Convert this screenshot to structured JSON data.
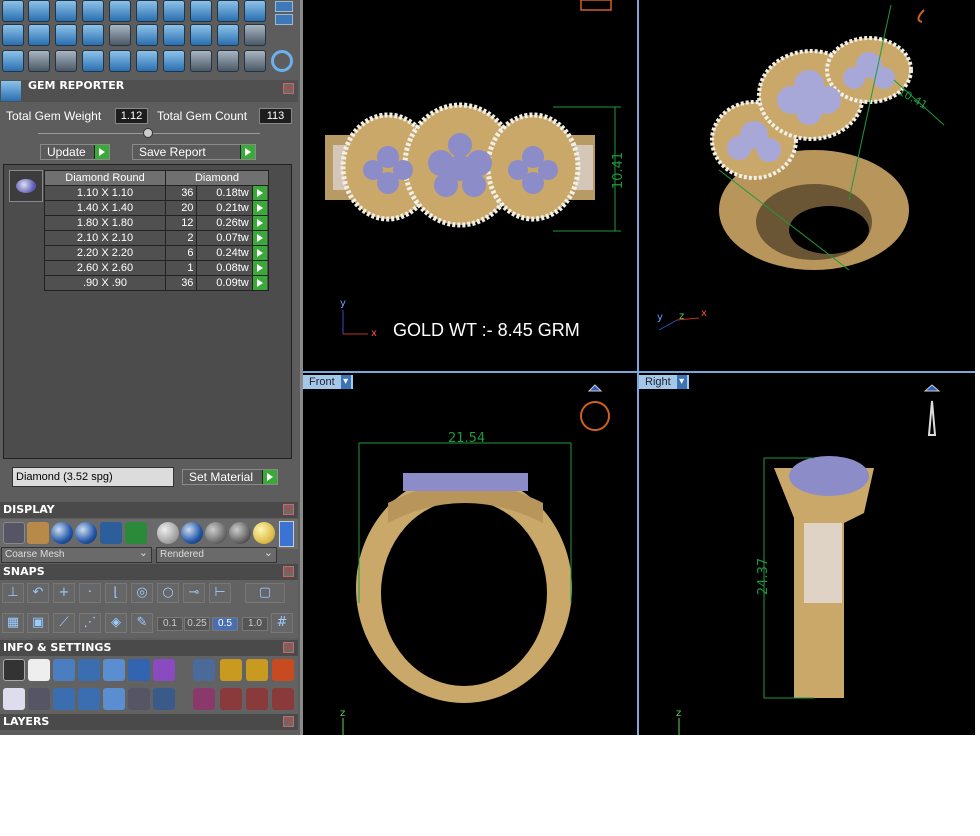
{
  "gem_reporter": {
    "title": "GEM REPORTER",
    "total_weight_label": "Total Gem Weight",
    "total_weight_value": "1.12",
    "total_count_label": "Total Gem Count",
    "total_count_value": "113",
    "update_label": "Update",
    "save_report_label": "Save Report",
    "table": {
      "headers": [
        "Diamond Round",
        "Diamond"
      ],
      "rows": [
        {
          "size": "1.10 X 1.10",
          "count": "36",
          "weight": "0.18tw"
        },
        {
          "size": "1.40 X 1.40",
          "count": "20",
          "weight": "0.21tw"
        },
        {
          "size": "1.80 X 1.80",
          "count": "12",
          "weight": "0.26tw"
        },
        {
          "size": "2.10 X 2.10",
          "count": "2",
          "weight": "0.07tw"
        },
        {
          "size": "2.20 X 2.20",
          "count": "6",
          "weight": "0.24tw"
        },
        {
          "size": "2.60 X 2.60",
          "count": "1",
          "weight": "0.08tw"
        },
        {
          "size": ".90 X .90",
          "count": "36",
          "weight": "0.09tw"
        }
      ]
    },
    "material_select": "Diamond    (3.52 spg)",
    "set_material_label": "Set Material"
  },
  "display": {
    "title": "DISPLAY",
    "mesh_select": "Coarse Mesh",
    "render_select": "Rendered"
  },
  "snaps": {
    "title": "SNAPS",
    "values": [
      "0.1",
      "0.25",
      "0.5",
      "1.0"
    ]
  },
  "info_settings": {
    "title": "INFO & SETTINGS"
  },
  "layers": {
    "title": "LAYERS"
  },
  "viewports": {
    "top": {
      "gold_weight": "GOLD WT :- 8.45 GRM",
      "dimension": "10.41",
      "axis_y": "y",
      "axis_x": "x"
    },
    "perspective": {
      "dimension": "10.41",
      "axes": [
        "y",
        "z",
        "x"
      ]
    },
    "front": {
      "tab": "Front",
      "dimension": "21.54",
      "axis_z": "z"
    },
    "right": {
      "tab": "Right",
      "dimension": "24.37",
      "axis_z": "z"
    }
  },
  "colors": {
    "panel_bg": "#5d5d5d",
    "accent_blue": "#6cb0f0",
    "go_green": "#3aa93a",
    "dimension_green": "#1e9a3c",
    "gold": "#c9a86a",
    "gem": "#8c8cc8"
  }
}
